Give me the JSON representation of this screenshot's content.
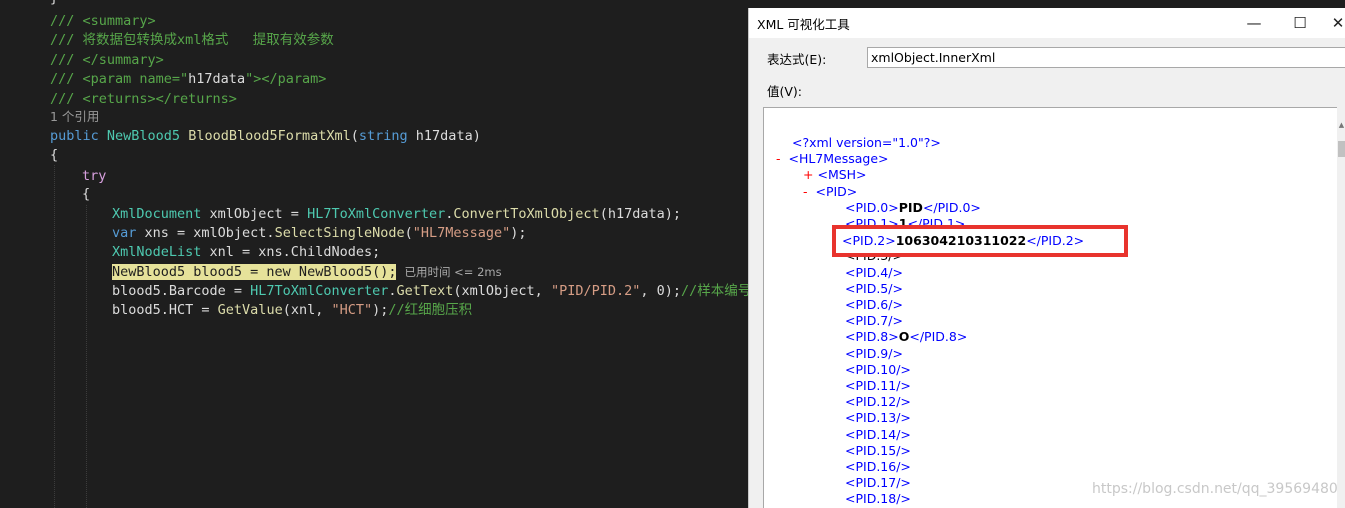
{
  "editor": {
    "top_brace": "}",
    "lines": {
      "summary_open": "/// <summary>",
      "summary_text": "/// 将数据包转换成xml格式   提取有效参数",
      "summary_close": "/// </summary>",
      "param_pre": "/// <param name=\"",
      "param_name": "h17data",
      "param_post": "\"></param>",
      "returns": "/// <returns></returns>",
      "refs": "1 个引用",
      "sig_public": "public ",
      "sig_type": "NewBlood5",
      "sig_method": " BloodBlood5FormatXml",
      "sig_open": "(",
      "sig_string": "string",
      "sig_param": " h17data)",
      "brace_open": "{",
      "try": "try",
      "try_brace": "{",
      "l1_type": "XmlDocument",
      "l1_rest": " xmlObject = ",
      "l1_class": "HL7ToXmlConverter",
      "l1_dot": ".",
      "l1_method": "ConvertToXmlObject",
      "l1_args": "(h17data);",
      "l2_var": "var",
      "l2_rest": " xns = xmlObject.",
      "l2_method": "SelectSingleNode",
      "l2_open": "(",
      "l2_str": "\"HL7Message\"",
      "l2_close": ");",
      "l3_type": "XmlNodeList",
      "l3_rest": " xnl = xns.ChildNodes;",
      "l4_stmt": "NewBlood5 blood5 = new NewBlood5();",
      "l4_elapsed": "已用时间 <= 2ms",
      "l5_pre": "blood5.Barcode = ",
      "l5_class": "HL7ToXmlConverter",
      "l5_dot": ".",
      "l5_method": "GetText",
      "l5_args": "(xmlObject, ",
      "l5_str": "\"PID/PID.2\"",
      "l5_tail": ", 0);",
      "l5_comment": "//样本编号",
      "l6_pre": "blood5.HCT = ",
      "l6_method": "GetValue",
      "l6_args": "(xnl, ",
      "l6_str": "\"HCT\"",
      "l6_tail": ");",
      "l6_comment": "//红细胞压积"
    }
  },
  "visualizer": {
    "title": "XML 可视化工具",
    "minimize": "—",
    "maximize": "☐",
    "close": "✕",
    "expression_label": "表达式(E):",
    "expression_value": "xmlObject.InnerXml",
    "value_label": "值(V):",
    "xml": {
      "decl": "<?xml version=\"1.0\"?>",
      "root_toggle": "-",
      "root": "<HL7Message>",
      "msh_toggle": "+",
      "msh": "<MSH>",
      "pid_toggle": "-",
      "pid": "<PID>",
      "pid0_open": "<PID.0>",
      "pid0_val": "PID",
      "pid0_close": "</PID.0>",
      "pid1_open": "<PID.1>",
      "pid1_val": "1",
      "pid1_close": "</PID.1>",
      "pid2_open": "<PID.2>",
      "pid2_val": "106304210311022",
      "pid2_close": "</PID.2>",
      "pid3": "<PID.3/>",
      "pid4": "<PID.4/>",
      "pid5": "<PID.5/>",
      "pid6": "<PID.6/>",
      "pid7": "<PID.7/>",
      "pid8_open": "<PID.8>",
      "pid8_val": "O",
      "pid8_close": "</PID.8>",
      "pid9": "<PID.9/>",
      "pid10": "<PID.10/>",
      "pid11": "<PID.11/>",
      "pid12": "<PID.12/>",
      "pid13": "<PID.13/>",
      "pid14": "<PID.14/>",
      "pid15": "<PID.15/>",
      "pid16": "<PID.16/>",
      "pid17": "<PID.17/>",
      "pid18": "<PID.18/>"
    }
  },
  "watermark": "https://blog.csdn.net/qq_39569480",
  "colors": {
    "editor_bg": "#1e1e1e",
    "highlight_stmt": "#e6e29a",
    "annotation_red": "#e8332d"
  }
}
